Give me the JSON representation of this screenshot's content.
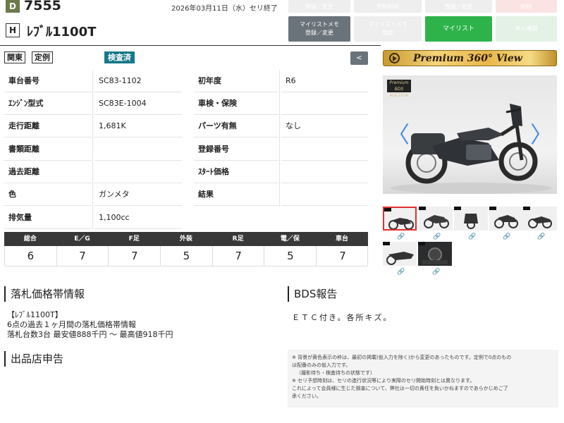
{
  "header": {
    "lot_badge": "D",
    "lot_number": "7555",
    "end_date": "2026年03月11日（水）セリ終了",
    "rank": "H",
    "model": "ﾚﾌﾞﾙ1100T"
  },
  "top_buttons": {
    "row1": [
      "登録／変更",
      "予約削除",
      "登録／変更",
      "削除"
    ],
    "mylist_memo_register": "マイリストメモ\n登録／変更",
    "mylist_memo_delete": "マイリストメモ\n削除",
    "mylist": "マイリスト",
    "invite": "本人確認"
  },
  "tags": {
    "region": "関東",
    "type": "定例",
    "inspection": "検査済",
    "collapse": "<"
  },
  "specs": [
    {
      "l1": "車台番号",
      "v1": "SC83-1102",
      "l2": "初年度",
      "v2": "R6"
    },
    {
      "l1": "ｴﾝｼﾞﾝ型式",
      "v1": "SC83E-1004",
      "l2": "車検・保険",
      "v2": ""
    },
    {
      "l1": "走行距離",
      "v1": "1,681K",
      "l2": "パーツ有無",
      "v2": "なし"
    },
    {
      "l1": "書類距離",
      "v1": "",
      "l2": "登録番号",
      "v2": ""
    },
    {
      "l1": "過去距離",
      "v1": "",
      "l2": "ｽﾀｰﾄ価格",
      "v2": ""
    },
    {
      "l1": "色",
      "v1": "ガンメタ",
      "l2": "結果",
      "v2": ""
    },
    {
      "l1": "排気量",
      "v1": "1,100cc"
    }
  ],
  "scores": {
    "headers": [
      "総合",
      "E／G",
      "F足",
      "外装",
      "R足",
      "電／保",
      "車台"
    ],
    "values": [
      "6",
      "7",
      "7",
      "5",
      "7",
      "5",
      "7"
    ]
  },
  "price_section": {
    "title": "落札価格帯情報",
    "line1": "【ﾚﾌﾞﾙ1100T】",
    "line2": "6点の過去１ヶ月間の落札価格帯情報",
    "line3": "落札台数3台 最安値888千円 〜 最高値918千円"
  },
  "shop_section": {
    "title": "出品店申告"
  },
  "bds_section": {
    "title": "BDS報告",
    "body": "ＥＴＣ付き。各所キズ。"
  },
  "notes": [
    "※ 背景が黄色表示の枠は、最初の掲載(仮入力を除く)から変更のあったものです。定例で0点のもの",
    "は配番のみの仮入力です。",
    "（撮影待ち・検査待ちの状態です）",
    "※ セリ予想時刻は、セリの進行状況等により実際のセリ開始時刻とは異なります。",
    "これによって会員様に生じた損害について、弊社は一切の責任を負いかねますのであらかじめご了",
    "承ください。"
  ],
  "premium": {
    "label": "Premium 360° View"
  },
  "photo": {
    "watermark": "Premium\nBDS AUCTION",
    "prev": "〈",
    "next": "〉"
  },
  "colors": {
    "inspection_badge": "#17788a",
    "mylist_button": "#2db34a",
    "score_header": "#383838",
    "carousel_arrow": "#4a8fe0",
    "selected_thumb": "#e03030"
  }
}
